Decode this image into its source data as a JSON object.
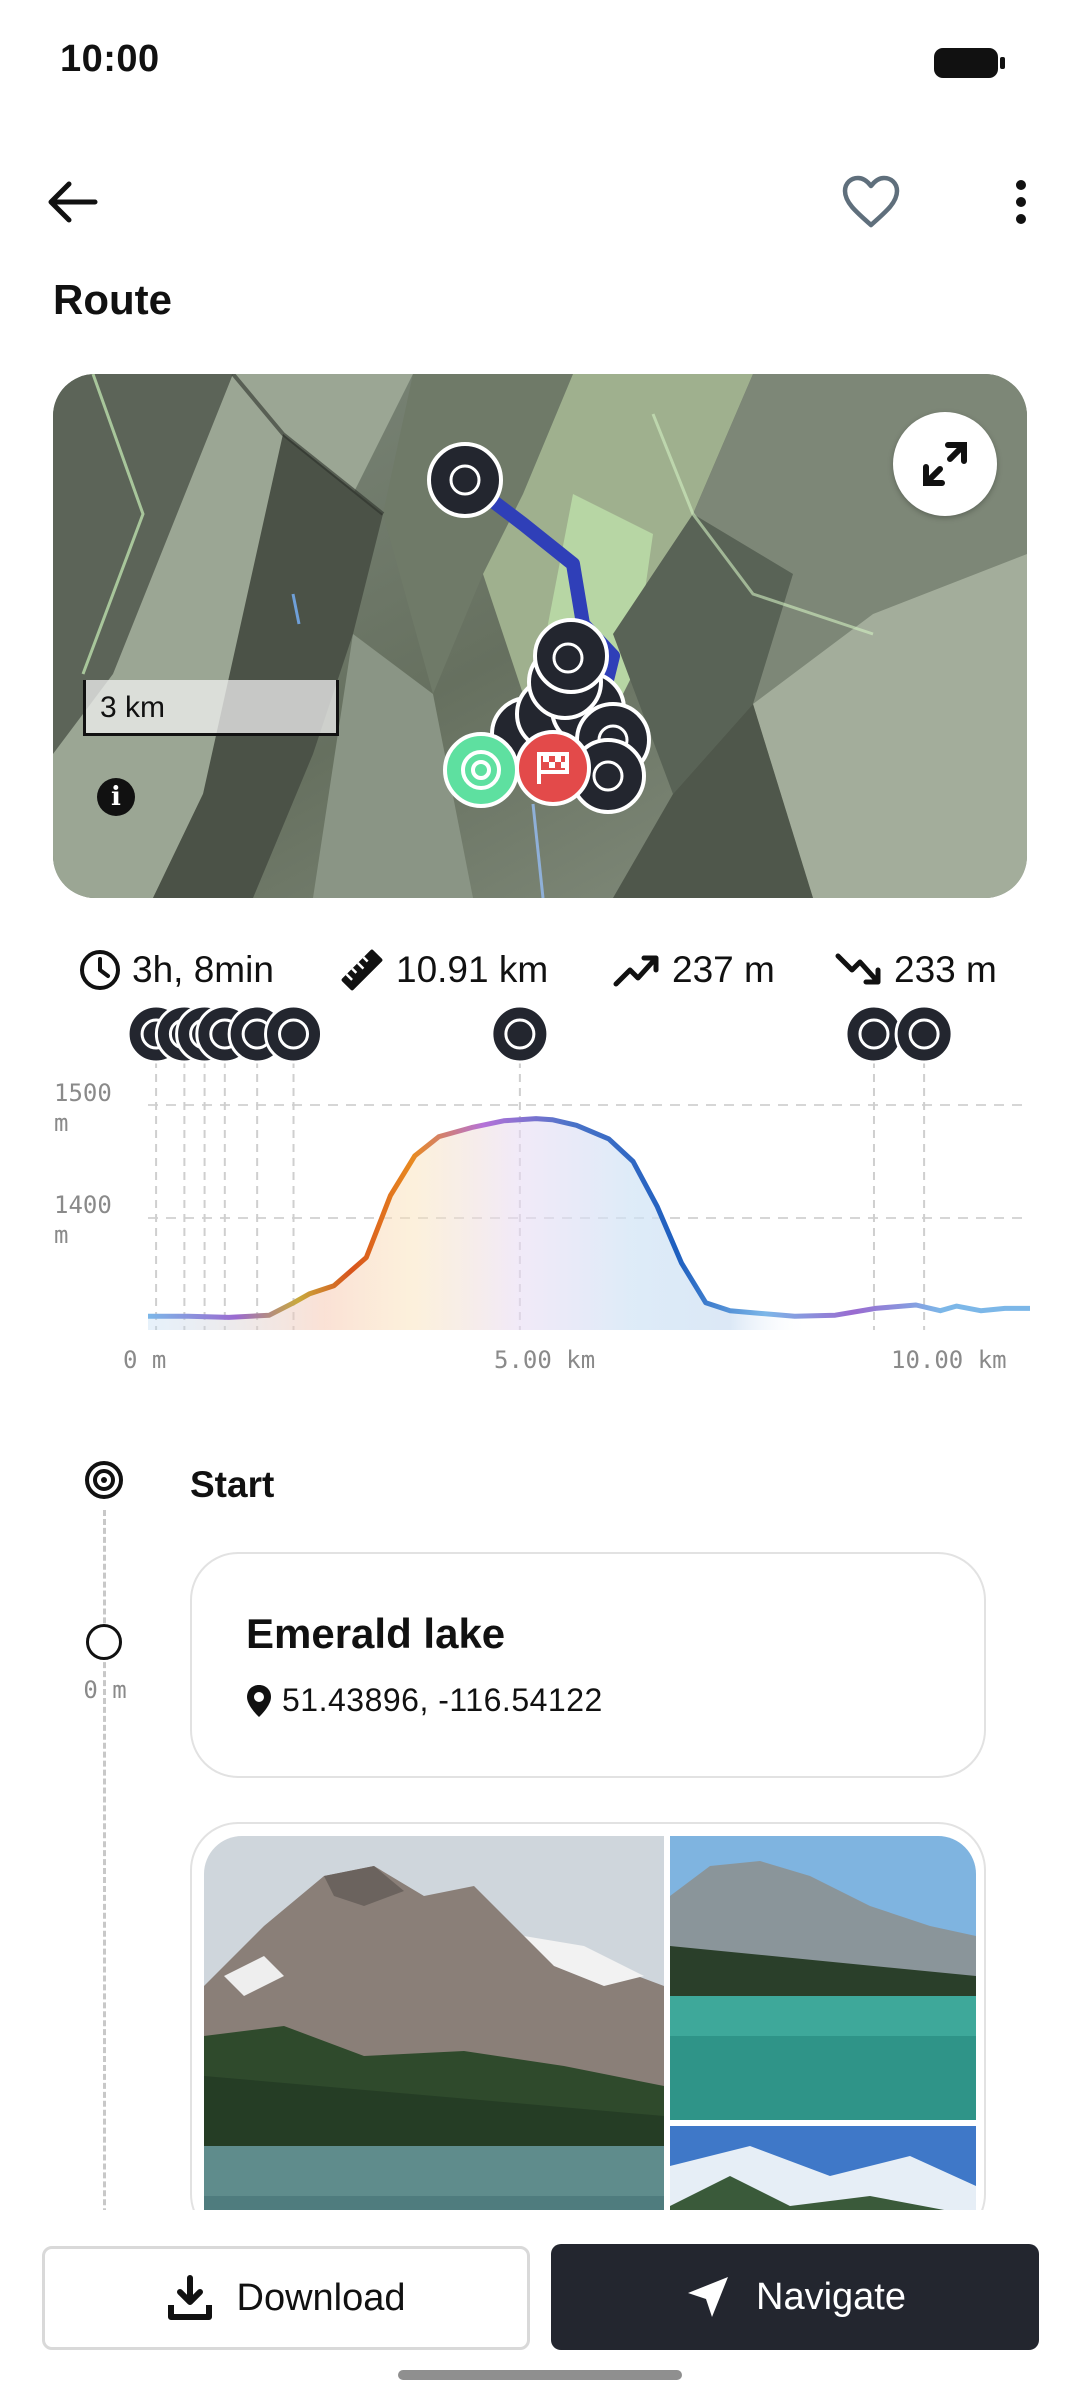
{
  "status_bar": {
    "time": "10:00",
    "battery_icon": "battery-icon"
  },
  "app_bar": {
    "back_icon": "arrow-left-icon",
    "favorite_icon": "heart-icon",
    "menu_icon": "more-vertical-icon"
  },
  "page": {
    "title": "Route"
  },
  "map": {
    "scale_label": "3 km",
    "info_glyph": "i",
    "expand_icon": "expand-arrows-icon",
    "route_color": "#2f3fb8",
    "start_color": "#5ee0a0",
    "finish_color": "#e34a4a"
  },
  "stats": {
    "duration": "3h, 8min",
    "distance": "10.91 km",
    "ascent": "237 m",
    "descent": "233 m"
  },
  "chart_data": {
    "type": "area",
    "title": "",
    "xlabel": "",
    "ylabel": "",
    "x_unit": "km",
    "y_unit": "m",
    "y_tick_labels": [
      "1500",
      "1400"
    ],
    "y_tick_unit": "m",
    "x_tick_labels": [
      "0 m",
      "5.00 km",
      "10.00 km"
    ],
    "ylim": [
      1310,
      1520
    ],
    "xlim": [
      0,
      10.91
    ],
    "grid": "dashed horizontal",
    "x": [
      0,
      0.5,
      1.0,
      1.5,
      1.8,
      2.0,
      2.3,
      2.7,
      3.0,
      3.3,
      3.6,
      4.0,
      4.4,
      4.8,
      5.0,
      5.3,
      5.7,
      6.0,
      6.3,
      6.6,
      6.9,
      7.2,
      7.5,
      8.0,
      8.5,
      9.0,
      9.5,
      9.8,
      10.0,
      10.3,
      10.6,
      10.91
    ],
    "y": [
      1313,
      1313,
      1312,
      1314,
      1325,
      1333,
      1340,
      1365,
      1420,
      1455,
      1472,
      1480,
      1486,
      1488,
      1487,
      1482,
      1470,
      1450,
      1410,
      1360,
      1325,
      1318,
      1316,
      1313,
      1314,
      1320,
      1323,
      1318,
      1322,
      1318,
      1320,
      1320
    ],
    "waypoint_markers_km": [
      0.1,
      0.45,
      0.7,
      0.95,
      1.35,
      1.8,
      4.6,
      8.98,
      9.6
    ],
    "marker_color": "#23262f"
  },
  "timeline": {
    "start_label": "Start",
    "start_icon": "target-icon",
    "waypoint": {
      "distance": "0 m",
      "name": "Emerald lake",
      "location_icon": "map-pin-icon",
      "coords": "51.43896, -116.54122"
    }
  },
  "bottom_bar": {
    "download_label": "Download",
    "download_icon": "download-icon",
    "navigate_label": "Navigate",
    "navigate_icon": "navigation-arrow-icon"
  }
}
